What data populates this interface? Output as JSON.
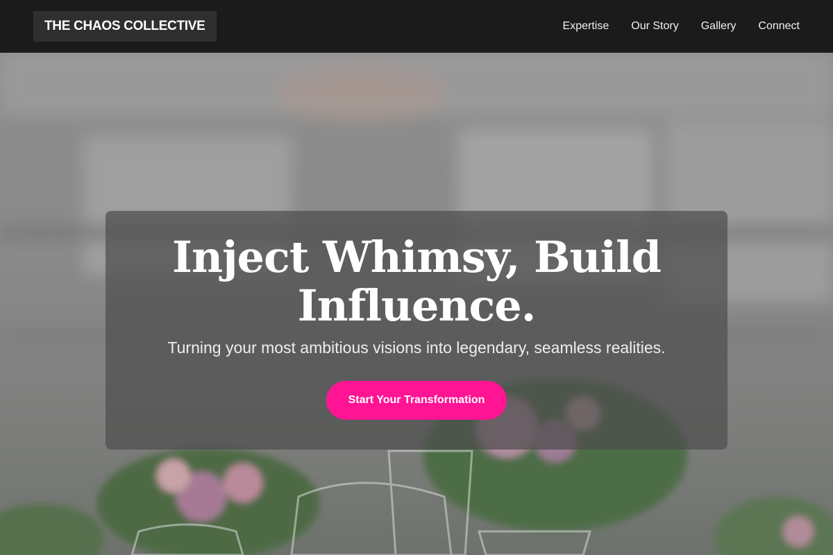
{
  "header": {
    "logo_text": "THE CHAOS COLLECTIVE",
    "nav": [
      {
        "label": "Expertise"
      },
      {
        "label": "Our Story"
      },
      {
        "label": "Gallery"
      },
      {
        "label": "Connect"
      }
    ]
  },
  "hero": {
    "headline": "Inject Whimsy, Build Influence.",
    "subheadline": "Turning your most ambitious visions into legendary, seamless realities.",
    "cta_label": "Start Your Transformation"
  },
  "colors": {
    "header_bg": "#1b1b1b",
    "logo_bg": "#2f2f2f",
    "cta_bg": "#ff1493",
    "card_bg": "rgba(78,78,78,0.72)"
  }
}
